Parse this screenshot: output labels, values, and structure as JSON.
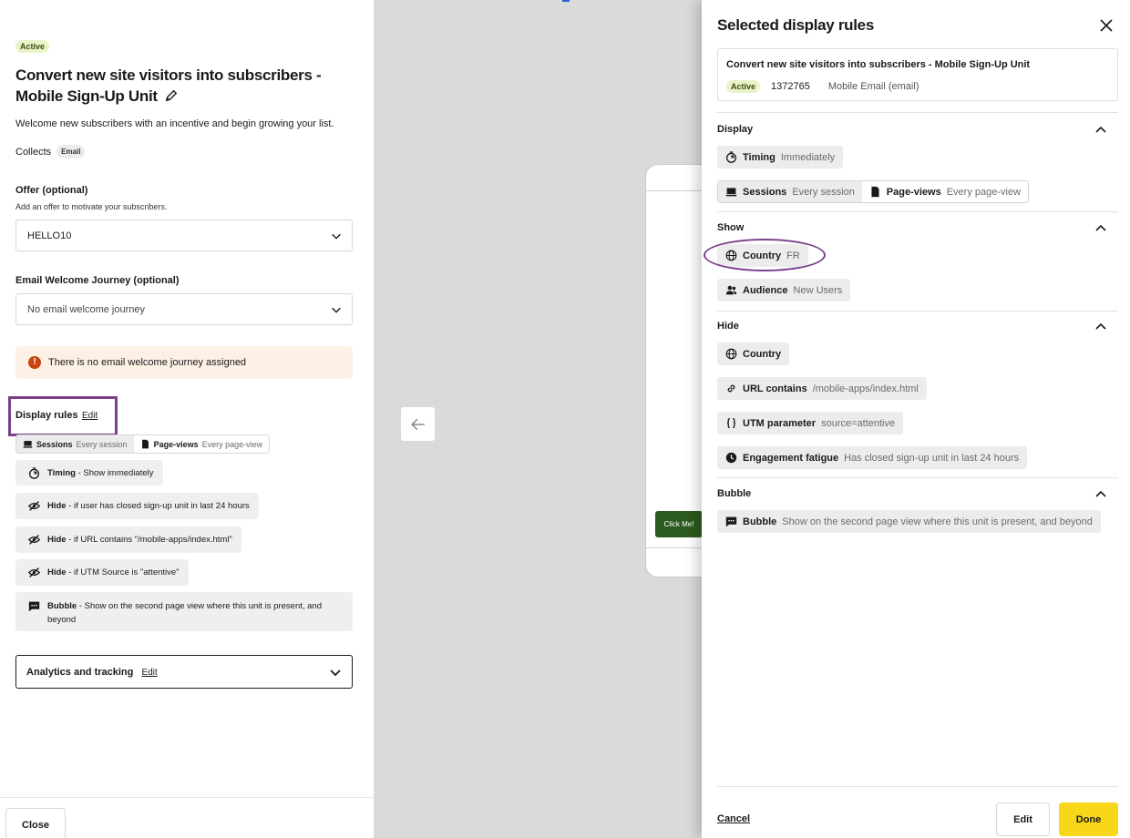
{
  "left": {
    "status": "Active",
    "title": "Convert new site visitors into subscribers - Mobile Sign-Up Unit",
    "description": "Welcome new subscribers with an incentive and begin growing your list.",
    "collects_label": "Collects",
    "collects_tag": "Email",
    "offer_label": "Offer (optional)",
    "offer_sub": "Add an offer to motivate your subscribers.",
    "offer_value": "HELLO10",
    "journey_label": "Email Welcome Journey (optional)",
    "journey_value": "No email welcome journey",
    "warning": "There is no email welcome journey assigned",
    "display_rules_label": "Display rules",
    "display_rules_edit": "Edit",
    "sessions_label": "Sessions",
    "sessions_value": "Every session",
    "pageviews_label": "Page-views",
    "pageviews_value": "Every page-view",
    "rules": [
      {
        "icon": "timer-icon",
        "bold": "Timing",
        "text": " - Show immediately"
      },
      {
        "icon": "eye-off-icon",
        "bold": "Hide",
        "text": " - if user has closed sign-up unit in last 24 hours"
      },
      {
        "icon": "eye-off-icon",
        "bold": "Hide",
        "text": " - if URL contains \"/mobile-apps/index.html\""
      },
      {
        "icon": "eye-off-icon",
        "bold": "Hide",
        "text": " - if UTM Source is \"attentive\""
      },
      {
        "icon": "chat-bubble-icon",
        "bold": "Bubble",
        "text": " - Show on the second page view where this unit is present, and beyond"
      }
    ],
    "analytics_label": "Analytics and tracking",
    "analytics_edit": "Edit",
    "close_label": "Close"
  },
  "middle": {
    "click_me": "Click Me!"
  },
  "right": {
    "title": "Selected display rules",
    "card_title": "Convert new site visitors into subscribers - Mobile Sign-Up Unit",
    "card_status": "Active",
    "card_id": "1372765",
    "card_channel": "Mobile Email (email)",
    "display_label": "Display",
    "timing_label": "Timing",
    "timing_value": "Immediately",
    "sessions_label": "Sessions",
    "sessions_value": "Every session",
    "pageviews_label": "Page-views",
    "pageviews_value": "Every page-view",
    "show_label": "Show",
    "show_country_label": "Country",
    "show_country_value": "FR",
    "audience_label": "Audience",
    "audience_value": "New Users",
    "hide_label": "Hide",
    "hide_country_label": "Country",
    "url_label": "URL contains",
    "url_value": "/mobile-apps/index.html",
    "utm_label": "UTM parameter",
    "utm_value": "source=attentive",
    "fatigue_label": "Engagement fatigue",
    "fatigue_value": "Has closed sign-up unit in last 24 hours",
    "bubble_section_label": "Bubble",
    "bubble_label": "Bubble",
    "bubble_value": "Show on the second page view where this unit is present, and beyond",
    "cancel_label": "Cancel",
    "edit_label": "Edit",
    "done_label": "Done"
  },
  "colors": {
    "accent_yellow": "#f8d619",
    "highlight_purple": "#7b3f8c",
    "active_badge_bg": "#e9f3c8",
    "warning_bg": "#fdf0e5",
    "warning_icon": "#c9450e",
    "click_me_green": "#2c5a1e"
  }
}
